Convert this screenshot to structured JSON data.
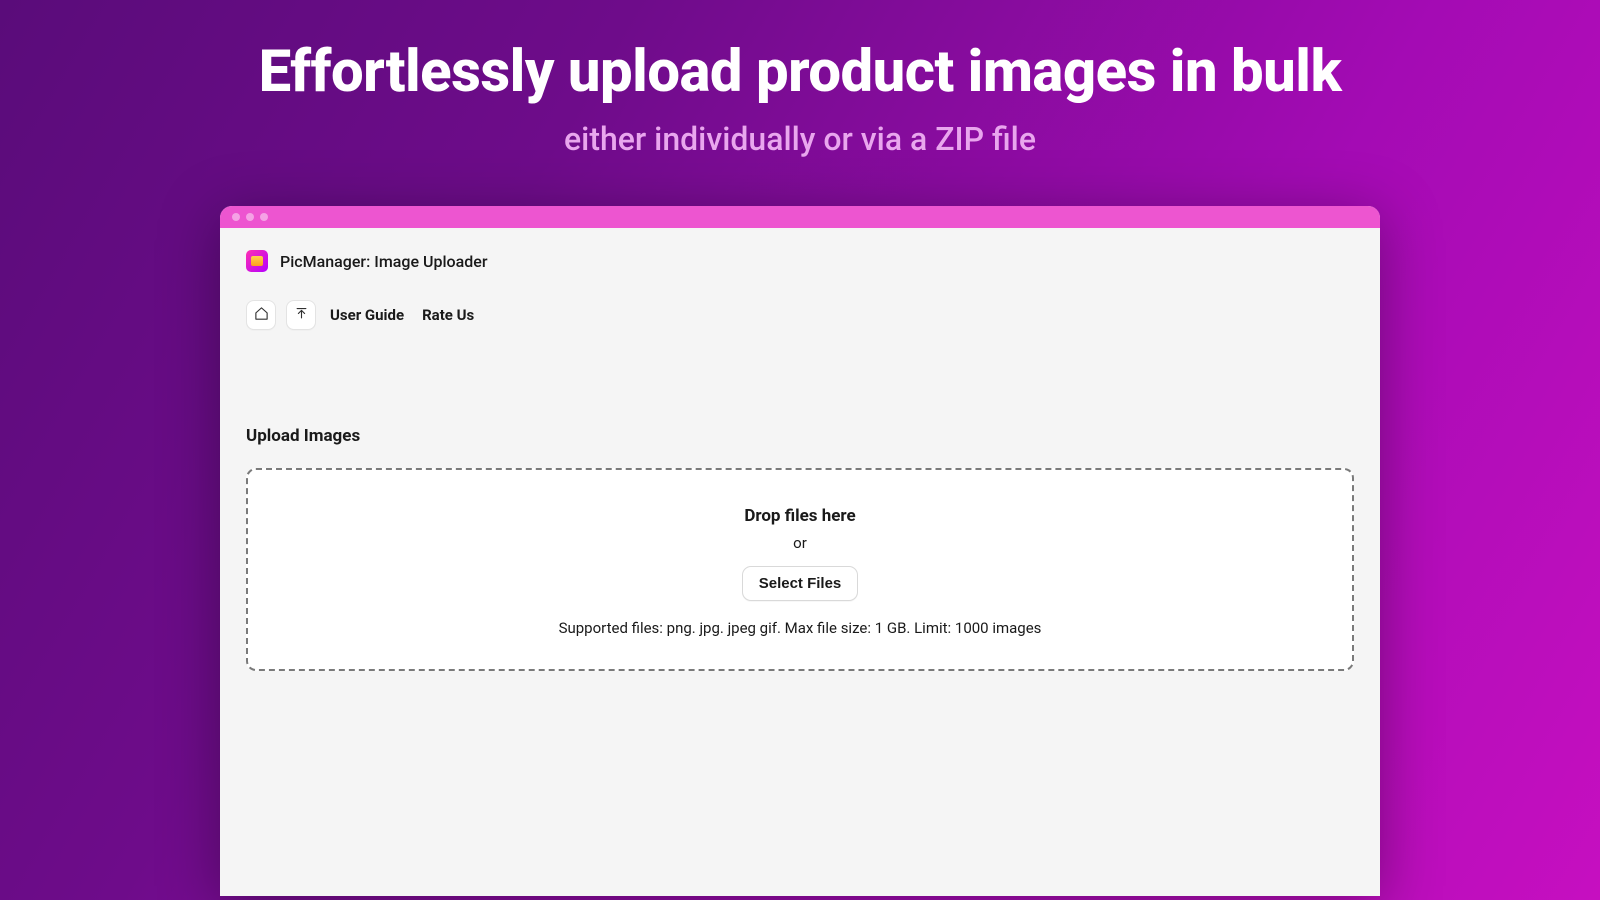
{
  "hero": {
    "title": "Effortlessly upload product images in bulk",
    "subtitle": "either individually or via a ZIP file"
  },
  "app": {
    "title": "PicManager: Image Uploader"
  },
  "toolbar": {
    "user_guide": "User Guide",
    "rate_us": "Rate Us"
  },
  "upload": {
    "section_title": "Upload Images",
    "drop_title": "Drop files here",
    "or": "or",
    "select_label": "Select Files",
    "hint": "Supported files: png. jpg. jpeg gif. Max file size: 1 GB. Limit: 1000 images"
  }
}
